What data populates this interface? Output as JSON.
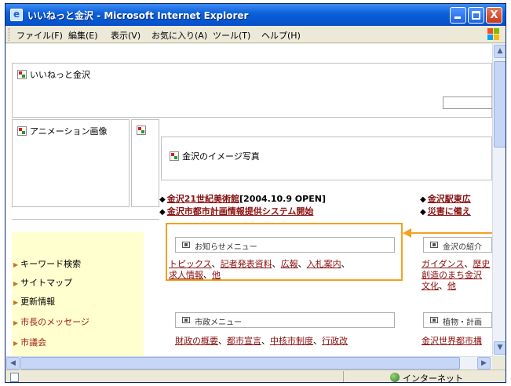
{
  "window": {
    "title": "いいねっと金沢 - Microsoft Internet Explorer",
    "min_label": "_",
    "max_label": "□",
    "close_label": "X"
  },
  "menubar": {
    "items": [
      "ファイル(F)",
      "編集(E)",
      "表示(V)",
      "お気に入り(A)",
      "ツール(T)",
      "ヘルプ(H)"
    ]
  },
  "page": {
    "frame_top_label": "いいねっと金沢",
    "anim_label": "アニメーション画像",
    "photo_label": "金沢のイメージ写真",
    "news": [
      {
        "link": "金沢21世紀美術館",
        "suffix": "[2004.10.9 OPEN]"
      },
      {
        "link": "金沢市都市計画情報提供システム開始",
        "suffix": ""
      },
      {
        "link": "金沢駅東広",
        "suffix": ""
      },
      {
        "link": "災害に備え",
        "suffix": ""
      }
    ],
    "nav": [
      "キーワード検索",
      "サイトマップ",
      "更新情報",
      "市長のメッセージ",
      "市議会"
    ],
    "boxes": [
      {
        "header": "お知らせメニュー",
        "line1": [
          "トピックス",
          "記者発表資料",
          "広報",
          "入札案内"
        ],
        "line2": [
          "求人情報",
          "他"
        ]
      },
      {
        "header": "金沢の紹介",
        "line1": [
          "ガイダンス",
          "歴史"
        ],
        "line2": [
          "創造のまち金沢"
        ],
        "line3": [
          "文化",
          "他"
        ]
      },
      {
        "header": "市政メニュー",
        "line1": [
          "財政の概要",
          "都市宣言",
          "中核市制度",
          "行政改"
        ],
        "line2": []
      },
      {
        "header": "植物・計画",
        "line1": [
          "金沢世界都市構"
        ],
        "line2": []
      }
    ]
  },
  "statusbar": {
    "zone": "インターネット"
  },
  "colors": {
    "titlebar": "#0a5fd8",
    "link": "#8a0f0f",
    "highlight": "#f5a020",
    "nav_bg": "#ffffd0"
  }
}
